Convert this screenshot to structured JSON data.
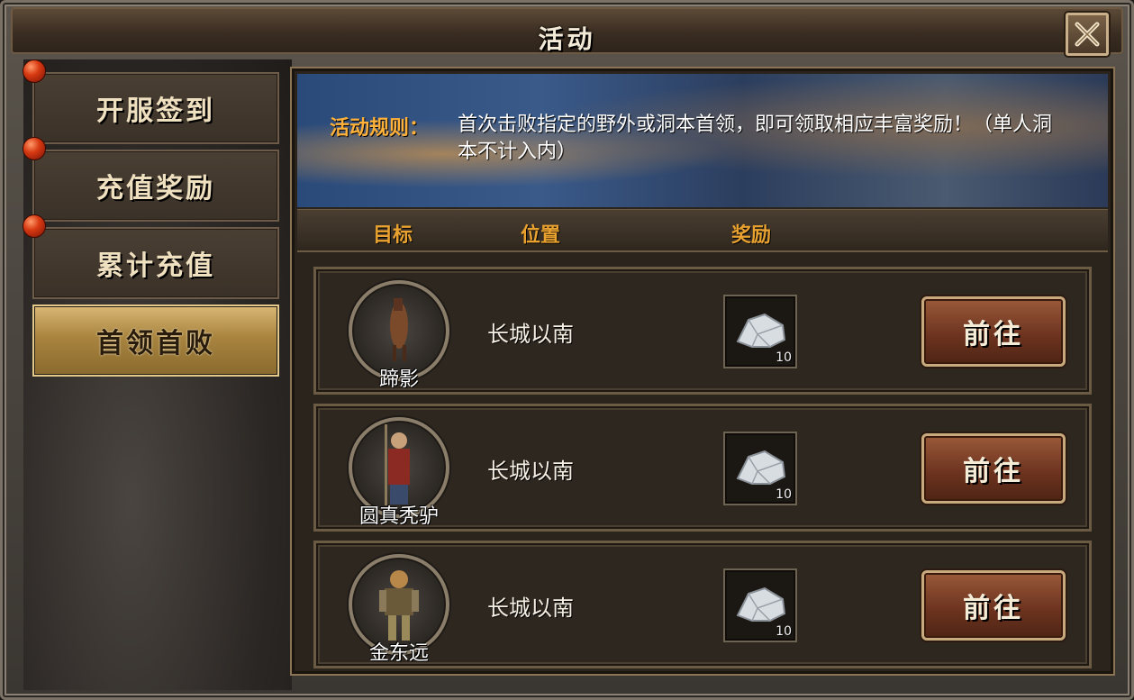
{
  "window": {
    "title": "活动",
    "close_icon": "close-x-icon"
  },
  "sidebar": {
    "items": [
      {
        "label": "开服签到",
        "active": false,
        "has_alert": true
      },
      {
        "label": "充值奖励",
        "active": false,
        "has_alert": true
      },
      {
        "label": "累计充值",
        "active": false,
        "has_alert": true
      },
      {
        "label": "首领首败",
        "active": true,
        "has_alert": false
      }
    ]
  },
  "banner": {
    "rule_label": "活动规则：",
    "rule_text": "首次击败指定的野外或洞本首领，即可领取相应丰富奖励！（单人洞本不计入内）"
  },
  "table": {
    "headers": {
      "target": "目标",
      "location": "位置",
      "reward": "奖励"
    },
    "rows": [
      {
        "boss": "蹄影",
        "location": "长城以南",
        "reward_icon": "silver-ore-icon",
        "reward_count": "10",
        "button": "前往"
      },
      {
        "boss": "圆真秃驴",
        "location": "长城以南",
        "reward_icon": "silver-ore-icon",
        "reward_count": "10",
        "button": "前往"
      },
      {
        "boss": "金东远",
        "location": "长城以南",
        "reward_icon": "silver-ore-icon",
        "reward_count": "10",
        "button": "前往"
      }
    ]
  },
  "colors": {
    "accent_gold": "#e9a230",
    "rule_label": "#ffb13a",
    "alert_red": "#d83a12"
  }
}
